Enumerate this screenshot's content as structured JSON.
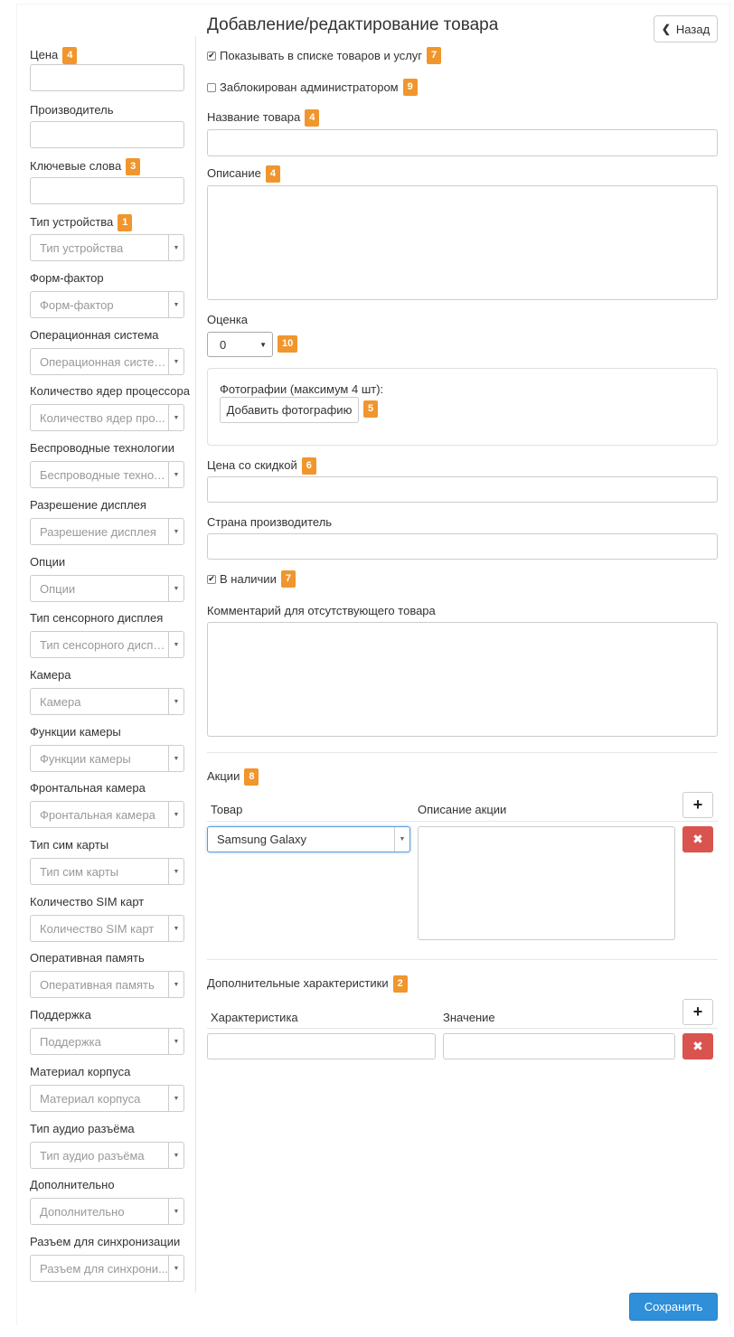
{
  "header": {
    "title": "Добавление/редактирование товара",
    "back_label": "Назад"
  },
  "left": {
    "price": {
      "label": "Цена",
      "badge": "4"
    },
    "manufacturer": {
      "label": "Производитель"
    },
    "keywords": {
      "label": "Ключевые слова",
      "badge": "3"
    },
    "device_type": {
      "label": "Тип устройства",
      "badge": "1",
      "placeholder": "Тип устройства"
    },
    "selects": [
      {
        "label": "Форм-фактор",
        "placeholder": "Форм-фактор"
      },
      {
        "label": "Операционная система",
        "placeholder": "Операционная система"
      },
      {
        "label": "Количество ядер процессора",
        "placeholder": "Количество ядер про..."
      },
      {
        "label": "Беспроводные технологии",
        "placeholder": "Беспроводные технол..."
      },
      {
        "label": "Разрешение дисплея",
        "placeholder": "Разрешение дисплея"
      },
      {
        "label": "Опции",
        "placeholder": "Опции"
      },
      {
        "label": "Тип сенсорного дисплея",
        "placeholder": "Тип сенсорного диспл..."
      },
      {
        "label": "Камера",
        "placeholder": "Камера"
      },
      {
        "label": "Функции камеры",
        "placeholder": "Функции камеры"
      },
      {
        "label": "Фронтальная камера",
        "placeholder": "Фронтальная камера"
      },
      {
        "label": "Тип сим карты",
        "placeholder": "Тип сим карты"
      },
      {
        "label": "Количество SIM карт",
        "placeholder": "Количество SIM карт"
      },
      {
        "label": "Оперативная память",
        "placeholder": "Оперативная память"
      },
      {
        "label": "Поддержка",
        "placeholder": "Поддержка"
      },
      {
        "label": "Материал корпуса",
        "placeholder": "Материал корпуса"
      },
      {
        "label": "Тип аудио разъёма",
        "placeholder": "Тип аудио разъёма"
      },
      {
        "label": "Дополнительно",
        "placeholder": "Дополнительно"
      },
      {
        "label": "Разъем для синхронизации",
        "placeholder": "Разъем для синхрони..."
      }
    ]
  },
  "right": {
    "show_in_list": {
      "label": "Показывать в списке товаров и услуг",
      "badge": "7",
      "checked": true
    },
    "blocked": {
      "label": "Заблокирован администратором",
      "badge": "9",
      "checked": false
    },
    "name": {
      "label": "Название товара",
      "badge": "4"
    },
    "description": {
      "label": "Описание",
      "badge": "4"
    },
    "rating": {
      "label": "Оценка",
      "value": "0",
      "badge": "10"
    },
    "photos": {
      "label": "Фотографии (максимум 4 шт):",
      "button": "Добавить фотографию",
      "badge": "5"
    },
    "discount_price": {
      "label": "Цена со скидкой",
      "badge": "6"
    },
    "country": {
      "label": "Страна производитель"
    },
    "in_stock": {
      "label": "В наличии",
      "badge": "7",
      "checked": true
    },
    "missing_comment": {
      "label": "Комментарий для отсутствующего товара"
    },
    "promotions": {
      "label": "Акции",
      "badge": "8",
      "col_product": "Товар",
      "col_description": "Описание акции",
      "selected_product": "Samsung Galaxy"
    },
    "extra": {
      "label": "Дополнительные характеристики",
      "badge": "2",
      "col_attr": "Характеристика",
      "col_value": "Значение"
    },
    "save_label": "Сохранить"
  },
  "colors": {
    "badge": "#f0962d",
    "primary": "#2f8fd8",
    "danger": "#d9534f"
  }
}
